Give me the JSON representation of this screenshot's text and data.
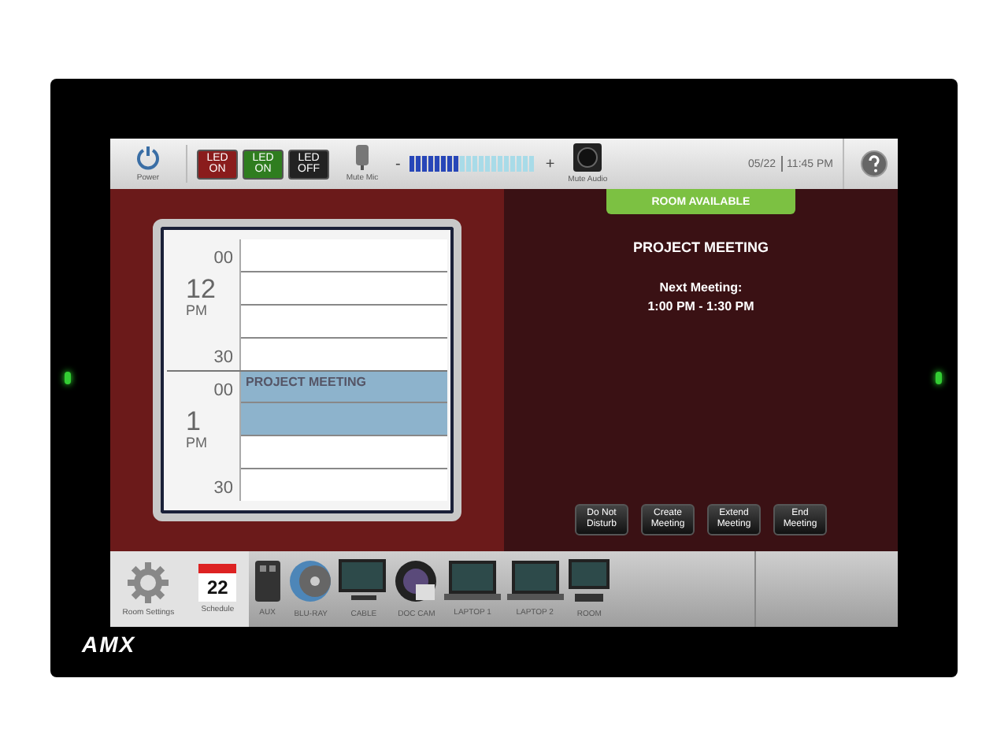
{
  "top_bar": {
    "power_label": "Power",
    "led_buttons": [
      {
        "label": "LED ON",
        "color": "#8a1c1c"
      },
      {
        "label": "LED ON",
        "color": "#2f7d1f"
      },
      {
        "label": "LED OFF",
        "color": "#222222"
      }
    ],
    "mute_mic_label": "Mute Mic",
    "volume": {
      "minus": "-",
      "plus": "+",
      "level": 0.4
    },
    "mute_audio_label": "Mute Audio",
    "date": "05/22",
    "time": "11:45 PM"
  },
  "schedule": {
    "hours": [
      {
        "hour": "12",
        "ampm": "PM",
        "marks": [
          "00",
          "30"
        ],
        "slots": [
          {
            "booked": false
          },
          {
            "booked": false
          },
          {
            "booked": false
          },
          {
            "booked": false
          }
        ]
      },
      {
        "hour": "1",
        "ampm": "PM",
        "marks": [
          "00",
          "30"
        ],
        "slots": [
          {
            "booked": true,
            "title": "PROJECT MEETING"
          },
          {
            "booked": true
          },
          {
            "booked": false
          },
          {
            "booked": false
          }
        ]
      }
    ]
  },
  "status": {
    "label": "ROOM AVAILABLE",
    "color": "#7cc142"
  },
  "current_meeting": "PROJECT MEETING",
  "next_meeting": {
    "label": "Next Meeting:",
    "time": "1:00 PM - 1:30 PM"
  },
  "actions": [
    "Do Not Disturb",
    "Create Meeting",
    "Extend Meeting",
    "End Meeting"
  ],
  "bottom_bar": {
    "room_settings": "Room Settings",
    "schedule": {
      "label": "Schedule",
      "day": "22"
    },
    "sources": [
      {
        "label": "AUX",
        "kind": "usb"
      },
      {
        "label": "BLU-RAY",
        "kind": "disc"
      },
      {
        "label": "CABLE",
        "kind": "tv"
      },
      {
        "label": "DOC CAM",
        "kind": "doccam"
      },
      {
        "label": "LAPTOP 1",
        "kind": "laptop"
      },
      {
        "label": "LAPTOP 2",
        "kind": "laptop"
      },
      {
        "label": "ROOM",
        "kind": "monitor"
      }
    ]
  },
  "logo": "AMX"
}
